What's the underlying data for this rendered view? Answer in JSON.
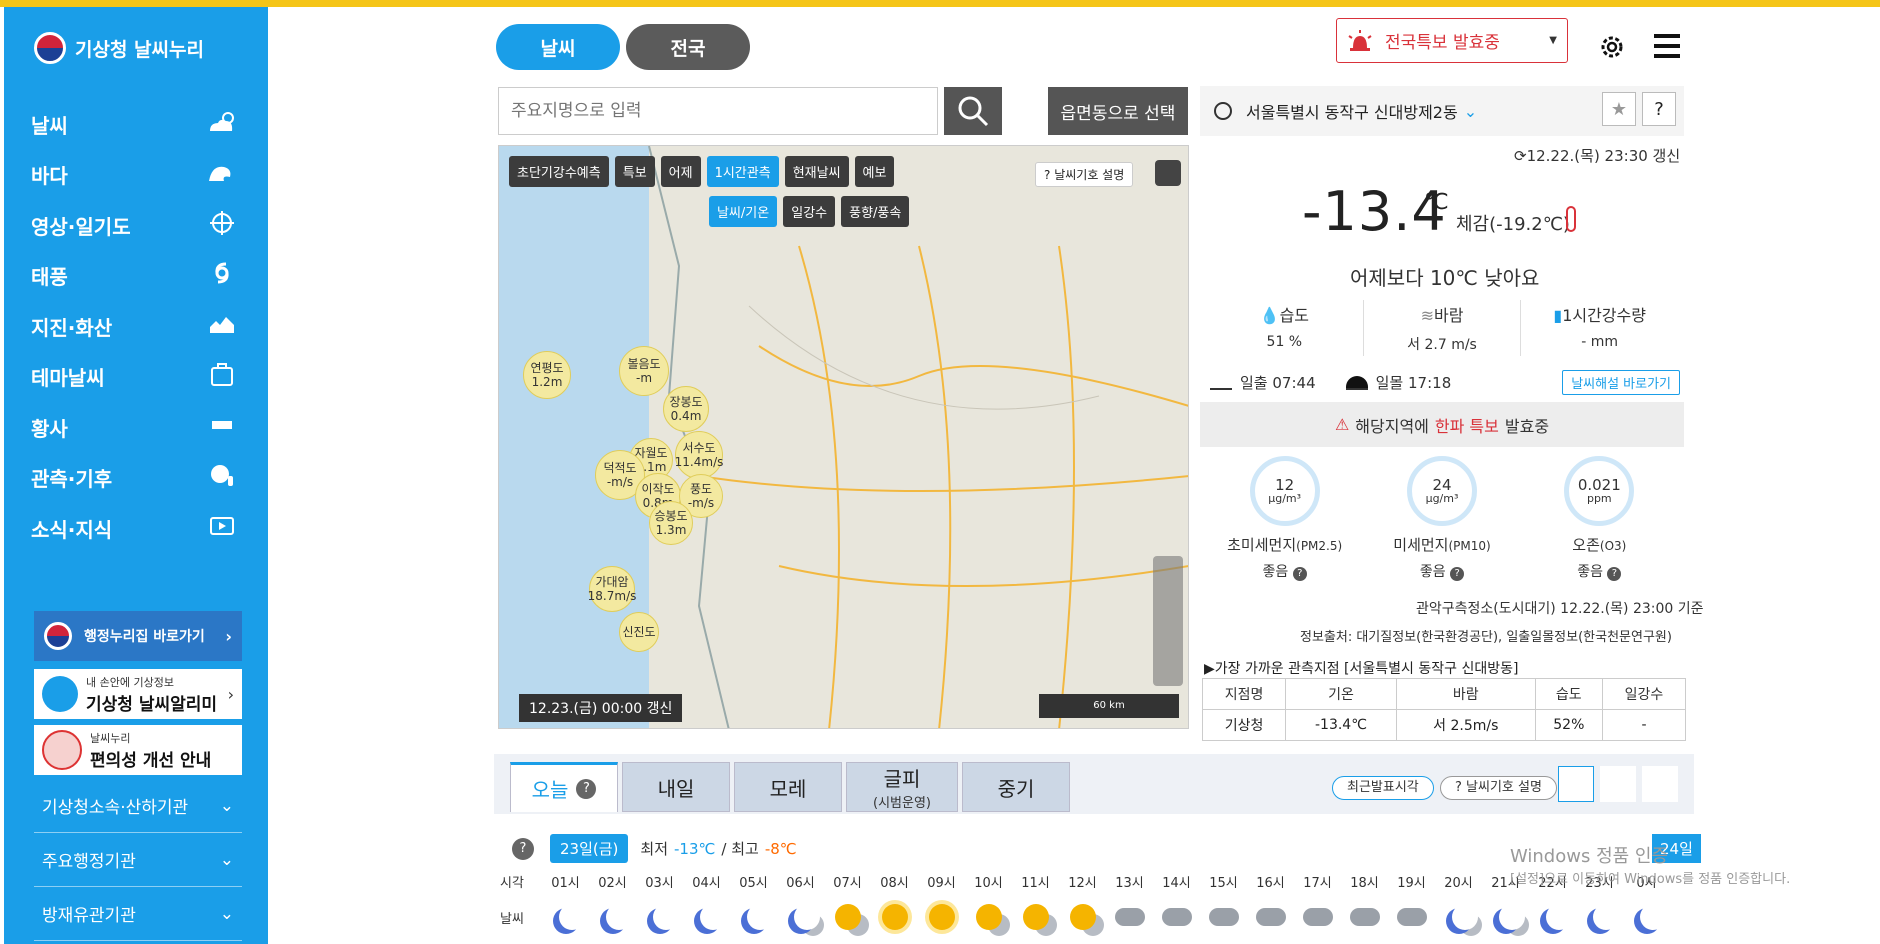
{
  "brand": {
    "title": "기상청 날씨누리"
  },
  "sidebar": {
    "menu": [
      {
        "label": "날씨",
        "icon": "cloud-sun-icon"
      },
      {
        "label": "바다",
        "icon": "wave-icon"
      },
      {
        "label": "영상·일기도",
        "icon": "satellite-icon"
      },
      {
        "label": "태풍",
        "icon": "typhoon-icon"
      },
      {
        "label": "지진·화산",
        "icon": "earthquake-icon"
      },
      {
        "label": "테마날씨",
        "icon": "suitcase-icon"
      },
      {
        "label": "황사",
        "icon": "dust-icon"
      },
      {
        "label": "관측·기후",
        "icon": "globe-icon"
      },
      {
        "label": "소식·지식",
        "icon": "play-icon"
      }
    ],
    "promo1": "행정누리집 바로가기",
    "promo2": {
      "small": "내 손안에 기상정보",
      "big": "기상청 날씨알리미"
    },
    "promo3": {
      "small": "날씨누리",
      "big": "편의성 개선 안내"
    },
    "orgs": [
      "기상청소속·산하기관",
      "주요행정기관",
      "방재유관기관"
    ]
  },
  "header": {
    "tab_weather": "날씨",
    "tab_nation": "전국",
    "alert": "전국특보 발효중",
    "search_placeholder": "주요지명으로 입력",
    "select_area": "읍면동으로 선택"
  },
  "map": {
    "tabs": [
      "초단기강수예측",
      "특보",
      "어제",
      "1시간관측",
      "현재날씨",
      "예보"
    ],
    "subtabs": [
      "날씨/기온",
      "일강수",
      "풍향/풍속"
    ],
    "legend_btn": "날씨기호 설명",
    "timestamp": "12.23.(금) 00:00 갱신",
    "scale": "60 km",
    "bubbles": [
      {
        "name": "연평도",
        "val": "1.2m"
      },
      {
        "name": "볼음도",
        "val": "-m"
      },
      {
        "name": "장봉도",
        "val": "0.4m"
      },
      {
        "name": "서수도",
        "val": "11.4m/s"
      },
      {
        "name": "자월도",
        "val": "4.1m"
      },
      {
        "name": "덕적도",
        "val": "-m/s"
      },
      {
        "name": "이작도",
        "val": "0.8m"
      },
      {
        "name": "풍도",
        "val": "-m/s"
      },
      {
        "name": "승봉도",
        "val": "1.3m"
      },
      {
        "name": "가대암",
        "val": "18.7m/s"
      },
      {
        "name": "신진도",
        "val": ""
      }
    ]
  },
  "current": {
    "location": "서울특별시 동작구 신대방제2동",
    "update": "12.22.(목) 23:30 갱신",
    "temp": "-13.4",
    "unit": "℃",
    "feel": "체감(-19.2℃)",
    "compare": "어제보다 10℃ 낮아요",
    "humidity_label": "습도",
    "humidity": "51 %",
    "wind_label": "바람",
    "wind": "서 2.7 m/s",
    "rain_label": "1시간강수량",
    "rain": "- mm",
    "sunrise_label": "일출",
    "sunrise": "07:44",
    "sunset_label": "일몰",
    "sunset": "17:18",
    "explain_btn": "날씨해설 바로가기",
    "warn_pre": "해당지역에",
    "warn_red": "한파 특보",
    "warn_post": "발효중"
  },
  "air": [
    {
      "value": "12",
      "unit": "μg/m³",
      "name": "초미세먼지",
      "sub": "(PM2.5)",
      "grade": "좋음"
    },
    {
      "value": "24",
      "unit": "μg/m³",
      "name": "미세먼지",
      "sub": "(PM10)",
      "grade": "좋음"
    },
    {
      "value": "0.021",
      "unit": "ppm",
      "name": "오존",
      "sub": "(O3)",
      "grade": "좋음"
    }
  ],
  "air_source": "관악구측정소(도시대기) 12.22.(목) 23:00 기준",
  "info_source": "정보출처: 대기질정보(한국환경공단), 일출일몰정보(한국천문연구원)",
  "nearest": {
    "title": "▶가장 가까운 관측지점 [서울특별시 동작구 신대방동]",
    "headers": [
      "지점명",
      "기온",
      "바람",
      "습도",
      "일강수"
    ],
    "row": [
      "기상청",
      "-13.4℃",
      "서 2.5m/s",
      "52%",
      "-"
    ]
  },
  "forecast": {
    "tabs": [
      "오늘",
      "내일",
      "모레",
      "글피",
      "중기"
    ],
    "tab4_sub": "(시범운영)",
    "recent_btn": "최근발표시각",
    "legend_btn": "날씨기호 설명",
    "day_badge": "23일(금)",
    "min_label": "최저",
    "min": "-13℃",
    "max_label": "최고",
    "max": "-8℃",
    "next_day": "24일",
    "time_label": "시각",
    "wx_label": "날씨",
    "hours": [
      "01시",
      "02시",
      "03시",
      "04시",
      "05시",
      "06시",
      "07시",
      "08시",
      "09시",
      "10시",
      "11시",
      "12시",
      "13시",
      "14시",
      "15시",
      "16시",
      "17시",
      "18시",
      "19시",
      "20시",
      "21시",
      "22시",
      "23시",
      "0시"
    ],
    "weather": [
      "moon",
      "moon",
      "moon",
      "moon",
      "moon",
      "moon-cloud",
      "sun-cloud",
      "sun",
      "sun",
      "sun-cloud",
      "sun-cloud",
      "sun-cloud",
      "cloud",
      "cloud",
      "cloud",
      "cloud",
      "cloud",
      "cloud",
      "cloud",
      "moon-cloud",
      "moon-cloud",
      "moon",
      "moon",
      "moon"
    ]
  },
  "watermark": {
    "line1": "Windows 정품 인증",
    "line2": "[설정]으로 이동하여 Windows를 정품 인증합니다."
  }
}
